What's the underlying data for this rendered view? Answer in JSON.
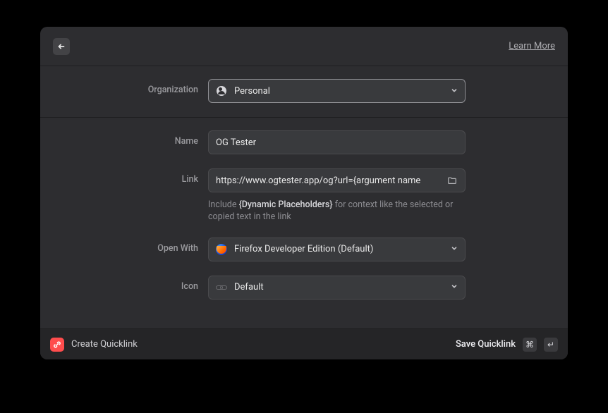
{
  "header": {
    "learn_more": "Learn More"
  },
  "form": {
    "organization_label": "Organization",
    "organization_value": "Personal",
    "name_label": "Name",
    "name_value": "OG Tester",
    "link_label": "Link",
    "link_value": "https://www.ogtester.app/og?url={argument name",
    "link_hint_prefix": "Include ",
    "link_hint_highlight": "{Dynamic Placeholders}",
    "link_hint_suffix": " for context like the selected or copied text in the link",
    "openwith_label": "Open With",
    "openwith_value": "Firefox Developer Edition (Default)",
    "icon_label": "Icon",
    "icon_value": "Default"
  },
  "footer": {
    "title": "Create Quicklink",
    "save_label": "Save Quicklink",
    "shortcut_cmd": "⌘",
    "shortcut_enter": "↵"
  }
}
